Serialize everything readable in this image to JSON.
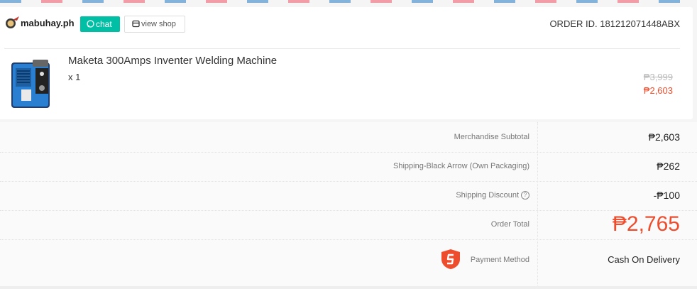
{
  "shop": {
    "name": "mabuhay.ph",
    "chat_label": "chat",
    "view_shop_label": "view shop",
    "order_id": "ORDER ID. 181212071448ABX"
  },
  "product": {
    "name": "Maketa 300Amps Inventer Welding Machine",
    "quantity": "x 1",
    "original_price": "₱3,999",
    "price": "₱2,603"
  },
  "summary": {
    "rows": [
      {
        "label": "Merchandise Subtotal",
        "value": "₱2,603"
      },
      {
        "label": "Shipping-Black Arrow (Own Packaging)",
        "value": "₱262"
      },
      {
        "label": "Shipping Discount",
        "value": "-₱100"
      },
      {
        "label": "Order Total",
        "value": "₱2,765"
      },
      {
        "label": "Payment Method",
        "value": "Cash On Delivery"
      }
    ]
  },
  "colors": {
    "accent": "#ee4d2d",
    "chat": "#00bfa5"
  }
}
